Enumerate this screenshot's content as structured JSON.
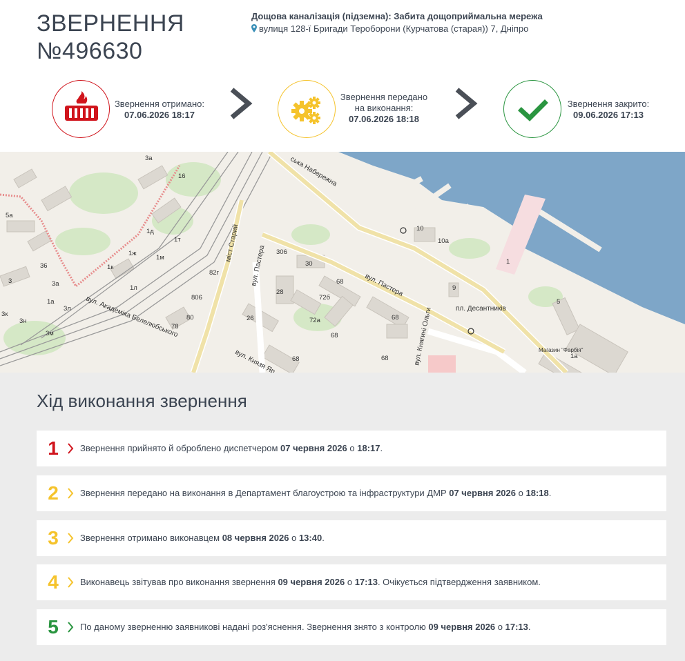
{
  "request": {
    "title_word": "ЗВЕРНЕННЯ",
    "number": "№496630",
    "category": "Дощова каналізація (підземна): Забита дощоприймальна мережа",
    "address": "вулиця 128-ї Бригади Тероборони (Курчатова (старая)) 7, Дніпро"
  },
  "steps": [
    {
      "label": "Звернення отримано:",
      "date": "07.06.2026 18:17",
      "icon": "sewer-grate-icon",
      "color": "#d0141c"
    },
    {
      "label": "Звернення передано на виконання:",
      "date": "07.06.2026 18:18",
      "icon": "gears-icon",
      "color": "#f5c32c"
    },
    {
      "label": "Звернення закрито:",
      "date": "09.06.2026 17:13",
      "icon": "checkmark-icon",
      "color": "#2a9540"
    }
  ],
  "map": {
    "labels": {
      "naberezhna": "ська Набережна",
      "pastera1": "вул. Пастера",
      "pastera2": "вул. Пастера",
      "most": "міст Старий",
      "akad": "вул. Академіка Белелюбського",
      "knyaza": "вул. Князя Яр",
      "olgy": "вул. Княгині Ольги",
      "ploshcha": "пл. Десантників",
      "magazin": "Магазин \"Фарбія\""
    },
    "house_numbers": [
      "3а",
      "16",
      "5а",
      "1д",
      "1т",
      "1ж",
      "1м",
      "36",
      "1к",
      "3",
      "3а",
      "1л",
      "1а",
      "3л",
      "3к",
      "3н",
      "3м",
      "306",
      "30",
      "82г",
      "806",
      "80",
      "78",
      "28",
      "68",
      "72б",
      "26",
      "72а",
      "68",
      "68",
      "68",
      "68",
      "10",
      "10а",
      "1",
      "9",
      "5",
      "1а",
      "вул"
    ]
  },
  "progress": {
    "title": "Хід виконання звернення",
    "items": [
      {
        "num": "1",
        "text": "Звернення прийнято й оброблено диспетчером ",
        "date": "07 червня 2026",
        "mid": " о ",
        "time": "18:17",
        "tail": "."
      },
      {
        "num": "2",
        "text": "Звернення передано на виконання в Департамент благоустрою та інфраструктури ДМР ",
        "date": "07 червня 2026",
        "mid": " о ",
        "time": "18:18",
        "tail": "."
      },
      {
        "num": "3",
        "text": "Звернення отримано виконавцем ",
        "date": "08 червня 2026",
        "mid": " о ",
        "time": "13:40",
        "tail": "."
      },
      {
        "num": "4",
        "text": "Виконавець звітував про виконання звернення ",
        "date": "09 червня 2026",
        "mid": " о ",
        "time": "17:13",
        "tail": ". Очікується підтвердження заявником."
      },
      {
        "num": "5",
        "text": "По даному зверненню заявникові надані роз'яснення. Звернення знято з контролю ",
        "date": "09 червня 2026",
        "mid": " о ",
        "time": "17:13",
        "tail": "."
      }
    ]
  },
  "colors": {
    "red": "#d0141c",
    "yellow": "#f5c32c",
    "green": "#2a9540",
    "text": "#3b4451",
    "water": "#7ea6c8",
    "panel": "#ececec"
  }
}
